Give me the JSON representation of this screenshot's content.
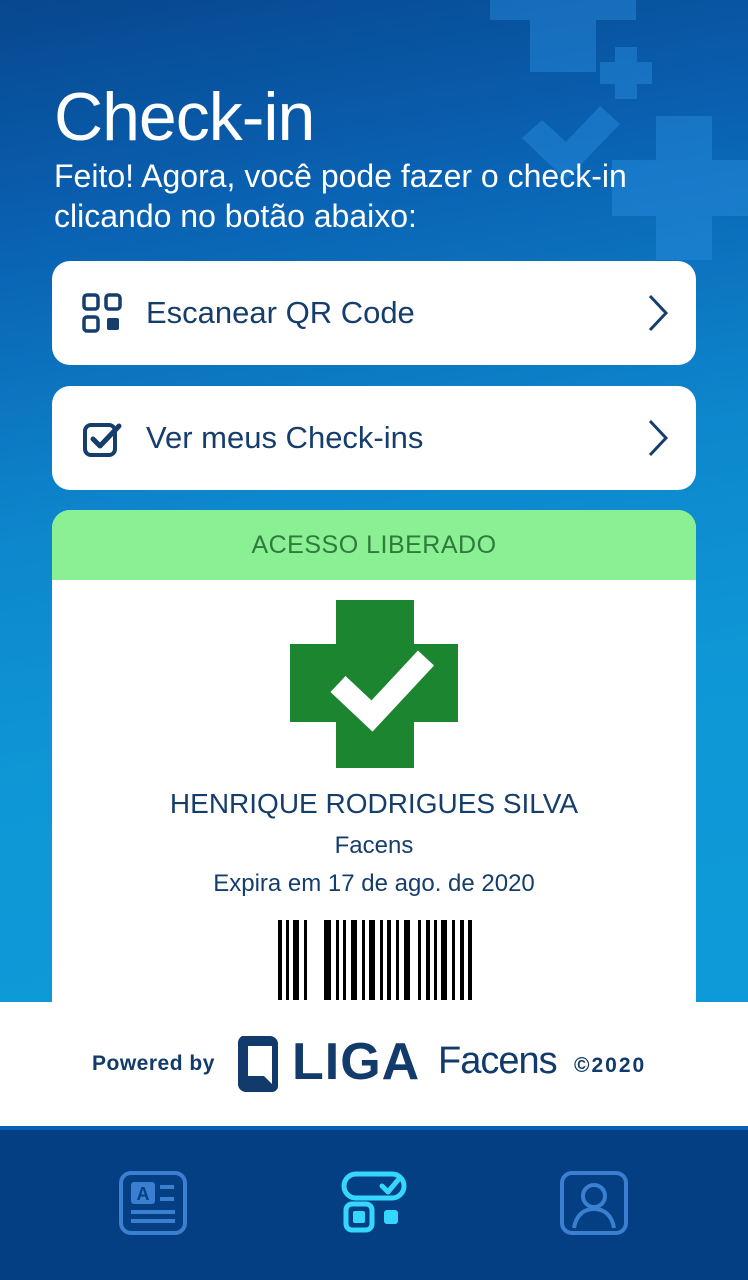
{
  "colors": {
    "accent_dark": "#163e6c",
    "access_banner_bg": "#8bef94",
    "access_banner_text": "#2f7b3b",
    "badge_green": "#1b852f",
    "tab_active": "#35d7ff",
    "tab_inactive": "#3a7fd0"
  },
  "header": {
    "title": "Check-in",
    "subtitle": "Feito! Agora, você pode fazer o check-in clicando no botão abaixo:"
  },
  "actions": [
    {
      "label": "Escanear QR Code",
      "icon": "qr-code-icon"
    },
    {
      "label": "Ver meus Check-ins",
      "icon": "checkbox-checked-icon"
    }
  ],
  "access": {
    "status": "ACESSO LIBERADO",
    "name": "HENRIQUE RODRIGUES SILVA",
    "institution": "Facens",
    "expiry": "Expira em 17 de ago. de 2020"
  },
  "footer": {
    "powered_by": "Powered by",
    "liga": "LIGA",
    "facens": "Facens",
    "copyright": "©2020"
  },
  "tabbar": {
    "tabs": [
      {
        "icon": "id-card-icon",
        "active": false
      },
      {
        "icon": "check-in-icon",
        "active": true
      },
      {
        "icon": "profile-icon",
        "active": false
      }
    ]
  }
}
